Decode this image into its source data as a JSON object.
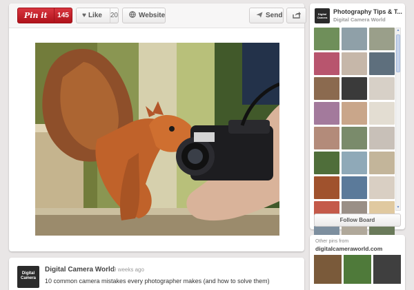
{
  "toolbar": {
    "pinit_label": "Pin it",
    "pinit_count": "145",
    "like_label": "Like",
    "like_count": "20",
    "website_label": "Website",
    "send_label": "Send"
  },
  "pin": {
    "author": "Digital Camera World",
    "time_ago": "• 9 weeks ago",
    "description": "10 common camera mistakes every photographer makes (and how to solve them)",
    "avatar_text": "Digital Camera"
  },
  "board": {
    "title": "Photography Tips & T...",
    "owner": "Digital Camera World",
    "avatar_text": "Digital Camera",
    "follow_label": "Follow Board",
    "thumbs": [
      "#6f8f5a",
      "#8fa0a8",
      "#9a9f8a",
      "#b8556e",
      "#c6b7a9",
      "#5e6f7d",
      "#8b6a4f",
      "#3a3a3a",
      "#d7d0c7",
      "#a37a9c",
      "#c9a68a",
      "#e3ddd2",
      "#b38b7a",
      "#7a8b6b",
      "#c8c0b8",
      "#4f6e3a",
      "#8fa9b8",
      "#c3b59a",
      "#a0522d",
      "#5b7a9a",
      "#d9cfc3",
      "#c45a4a",
      "#9a8f86",
      "#e0c9a0",
      "#7d8f9f",
      "#b0a89a",
      "#6a7a5a"
    ]
  },
  "other_pins": {
    "heading": "Other pins from",
    "domain": "digitalcameraworld.com",
    "thumbs": [
      "#7a5a3a",
      "#4f7a3a",
      "#3f3f3f"
    ]
  }
}
